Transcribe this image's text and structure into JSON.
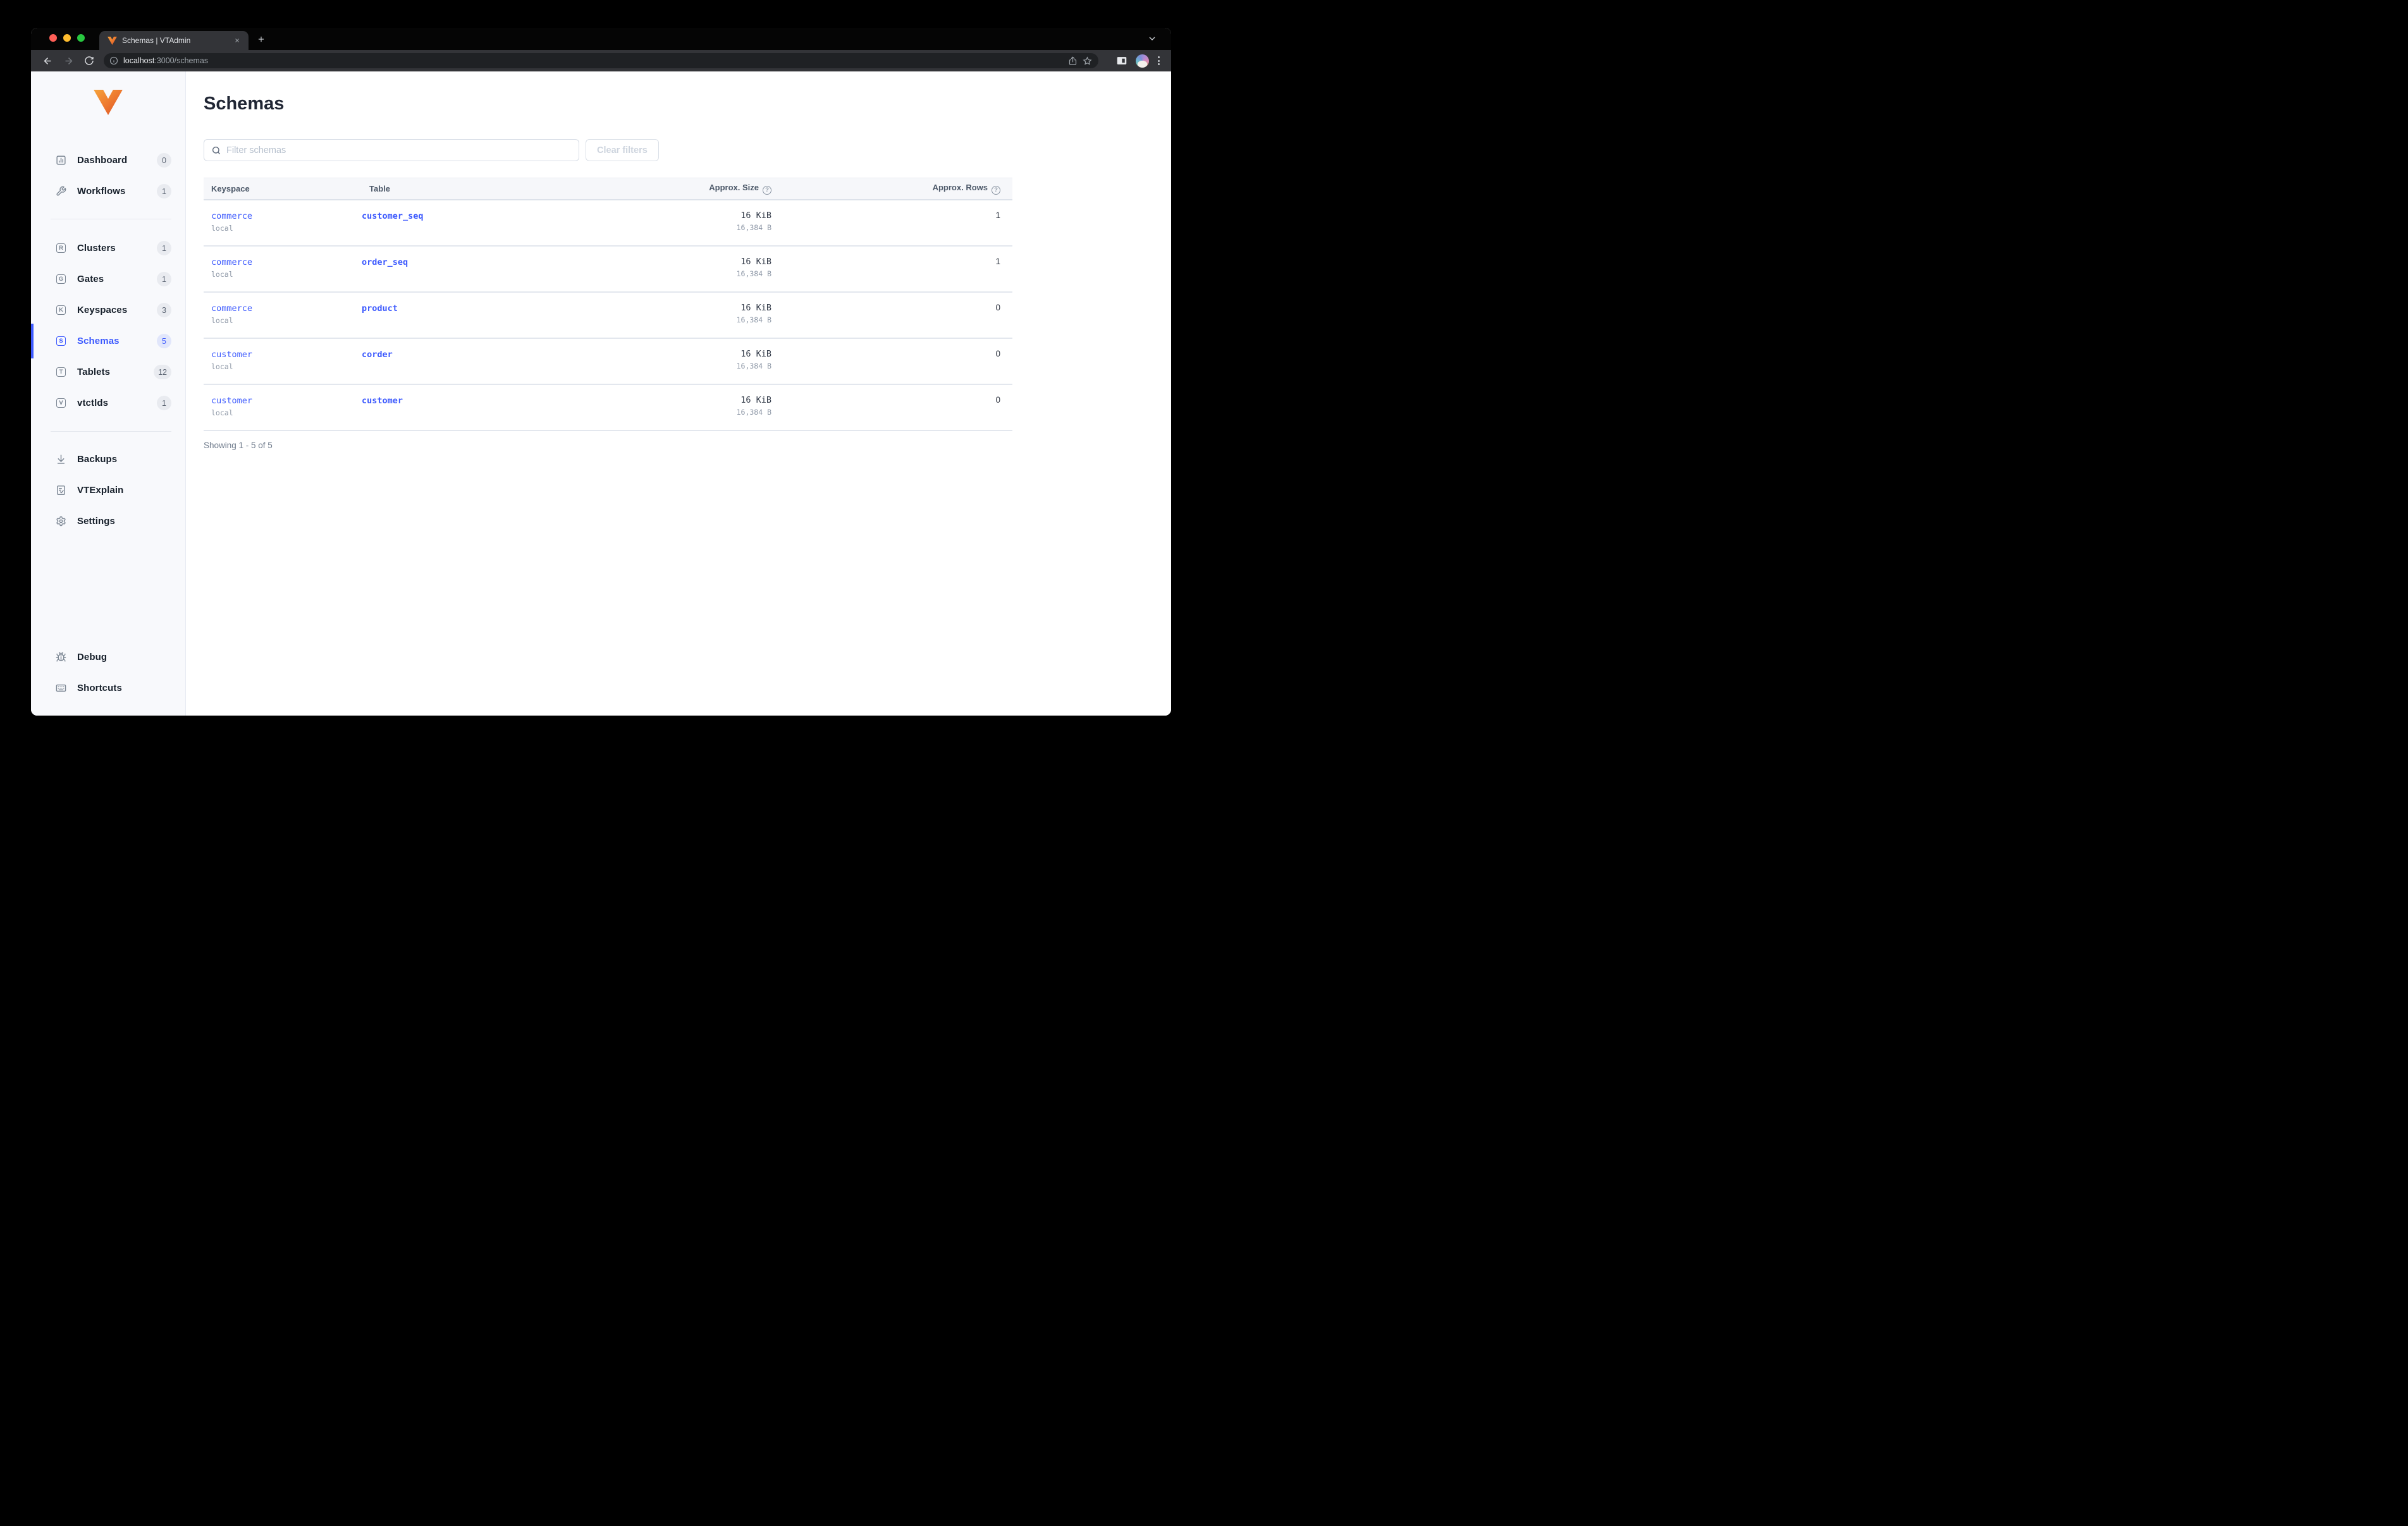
{
  "browser": {
    "tab": {
      "title": "Schemas | VTAdmin"
    },
    "address": {
      "host": "localhost",
      "path": ":3000/schemas"
    }
  },
  "sidebar": {
    "sections": [
      {
        "items": [
          {
            "label": "Dashboard",
            "count": "0",
            "icon": "dashboard"
          },
          {
            "label": "Workflows",
            "count": "1",
            "icon": "wrench"
          }
        ]
      },
      {
        "items": [
          {
            "label": "Clusters",
            "count": "1",
            "icon": "letter",
            "letter": "R"
          },
          {
            "label": "Gates",
            "count": "1",
            "icon": "letter",
            "letter": "G"
          },
          {
            "label": "Keyspaces",
            "count": "3",
            "icon": "letter",
            "letter": "K"
          },
          {
            "label": "Schemas",
            "count": "5",
            "icon": "letter",
            "letter": "S",
            "active": true
          },
          {
            "label": "Tablets",
            "count": "12",
            "icon": "letter",
            "letter": "T"
          },
          {
            "label": "vtctlds",
            "count": "1",
            "icon": "letter",
            "letter": "V"
          }
        ]
      },
      {
        "items": [
          {
            "label": "Backups",
            "icon": "download"
          },
          {
            "label": "VTExplain",
            "icon": "doc-check"
          },
          {
            "label": "Settings",
            "icon": "gear"
          }
        ]
      }
    ],
    "bottom_items": [
      {
        "label": "Debug",
        "icon": "bug"
      },
      {
        "label": "Shortcuts",
        "icon": "keyboard"
      }
    ]
  },
  "main": {
    "title": "Schemas",
    "filter": {
      "placeholder": "Filter schemas",
      "clear_label": "Clear filters"
    },
    "table": {
      "headers": [
        "Keyspace",
        "Table",
        "Approx. Size",
        "Approx. Rows"
      ],
      "help_glyph": "?",
      "rows": [
        {
          "keyspace": "commerce",
          "cluster": "local",
          "table": "customer_seq",
          "size": "16 KiB",
          "size_bytes": "16,384 B",
          "rows": "1"
        },
        {
          "keyspace": "commerce",
          "cluster": "local",
          "table": "order_seq",
          "size": "16 KiB",
          "size_bytes": "16,384 B",
          "rows": "1"
        },
        {
          "keyspace": "commerce",
          "cluster": "local",
          "table": "product",
          "size": "16 KiB",
          "size_bytes": "16,384 B",
          "rows": "0"
        },
        {
          "keyspace": "customer",
          "cluster": "local",
          "table": "corder",
          "size": "16 KiB",
          "size_bytes": "16,384 B",
          "rows": "0"
        },
        {
          "keyspace": "customer",
          "cluster": "local",
          "table": "customer",
          "size": "16 KiB",
          "size_bytes": "16,384 B",
          "rows": "0"
        }
      ]
    },
    "footer": "Showing 1 - 5 of 5"
  },
  "colors": {
    "accent": "#3d5afe",
    "logo_orange_top": "#f6a33c",
    "logo_orange_mid": "#ee7a2f",
    "logo_orange_deep": "#d94f26",
    "traffic_close": "#ff5f57",
    "traffic_min": "#febc2e",
    "traffic_max": "#28c840"
  }
}
